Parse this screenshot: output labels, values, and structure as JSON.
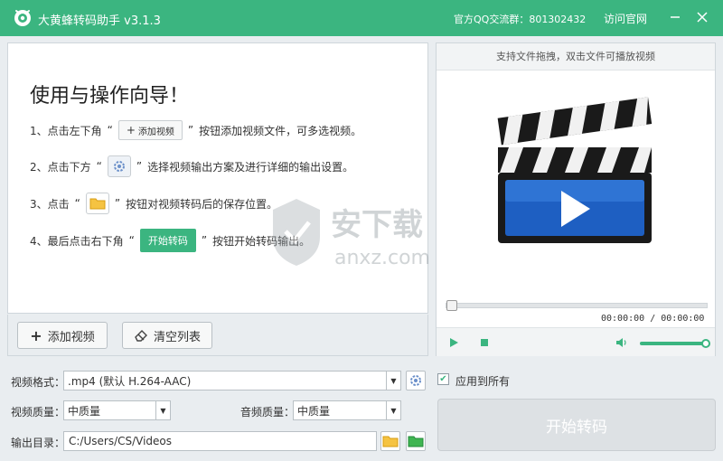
{
  "titlebar": {
    "title": "大黄蜂转码助手 v3.1.3",
    "qq_group": "官方QQ交流群：801302432",
    "site_link": "访问官网"
  },
  "guide": {
    "heading": "使用与操作向导！",
    "step1_pre": "1、点击左下角",
    "step1_btn": "添加视频",
    "step1_post": "按钮添加视频文件，可多选视频。",
    "step2_pre": "2、点击下方",
    "step2_post": "选择视频输出方案及进行详细的输出设置。",
    "step3_pre": "3、点击",
    "step3_post": "按钮对视频转码后的保存位置。",
    "step4_pre": "4、最后点击右下角",
    "step4_btn": "开始转码",
    "step4_post": "按钮开始转码输出。",
    "quote_open": "“",
    "quote_close": "”"
  },
  "watermark": {
    "text": "安下载",
    "sub": "anxz.com"
  },
  "list_toolbar": {
    "add_label": "添加视频",
    "clear_label": "清空列表"
  },
  "player": {
    "hint": "支持文件拖拽，双击文件可播放视频",
    "current_time": "00:00:00",
    "total_time": "00:00:00",
    "time_separator": "/",
    "volume": 1.0
  },
  "settings": {
    "format_label": "视频格式：",
    "format_value": ".mp4 (默认 H.264-AAC)",
    "video_quality_label": "视频质量：",
    "video_quality_value": "中质量",
    "audio_quality_label": "音频质量：",
    "audio_quality_value": "中质量",
    "output_label": "输出目录：",
    "output_value": "C:/Users/CS/Videos",
    "apply_all_label": "应用到所有",
    "apply_all_checked": true
  },
  "start_button": "开始转码",
  "colors": {
    "accent": "#3bb580",
    "panel": "#ffffff",
    "background": "#e9edf0"
  }
}
